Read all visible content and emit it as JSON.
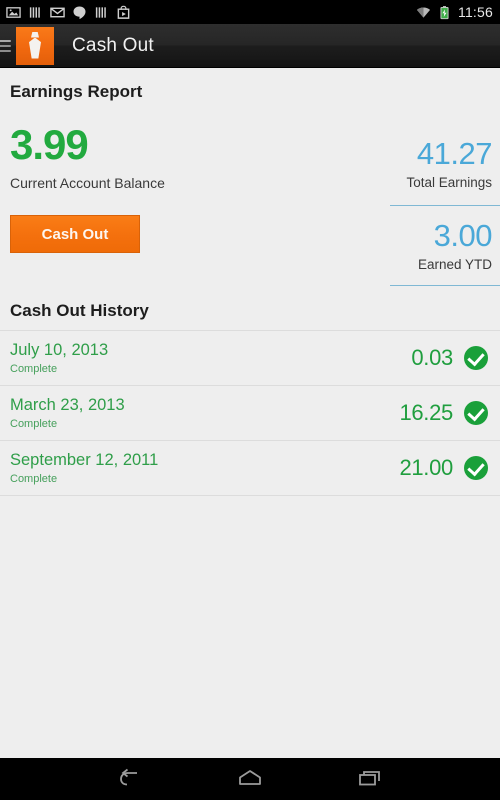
{
  "status_bar": {
    "icons": [
      "screenshot-icon",
      "barcode-icon",
      "gmail-icon",
      "hangouts-icon",
      "barcode-icon-2",
      "play-store-icon"
    ],
    "wifi_icon": "wifi-icon",
    "battery_icon": "battery-charging-icon",
    "time": "11:56"
  },
  "action_bar": {
    "menu_icon": "hamburger-menu-icon",
    "app_icon": "necktie-app-icon",
    "title": "Cash Out"
  },
  "earnings": {
    "section_title": "Earnings Report",
    "balance_value": "3.99",
    "balance_label": "Current Account Balance",
    "cash_out_button": "Cash Out",
    "total_value": "41.27",
    "total_label": "Total Earnings",
    "ytd_value": "3.00",
    "ytd_label": "Earned YTD"
  },
  "history": {
    "section_title": "Cash Out History",
    "rows": [
      {
        "date": "July 10, 2013",
        "status": "Complete",
        "amount": "0.03",
        "status_icon": "check-circle-icon"
      },
      {
        "date": "March 23, 2013",
        "status": "Complete",
        "amount": "16.25",
        "status_icon": "check-circle-icon"
      },
      {
        "date": "September 12, 2011",
        "status": "Complete",
        "amount": "21.00",
        "status_icon": "check-circle-icon"
      }
    ]
  },
  "nav_bar": {
    "back_icon": "back-arrow-icon",
    "home_icon": "home-icon",
    "recents_icon": "recents-icon"
  },
  "colors": {
    "accent_orange": "#f4700d",
    "green": "#22aa3f",
    "blue": "#4aa8d8",
    "background": "#eeeeee"
  }
}
